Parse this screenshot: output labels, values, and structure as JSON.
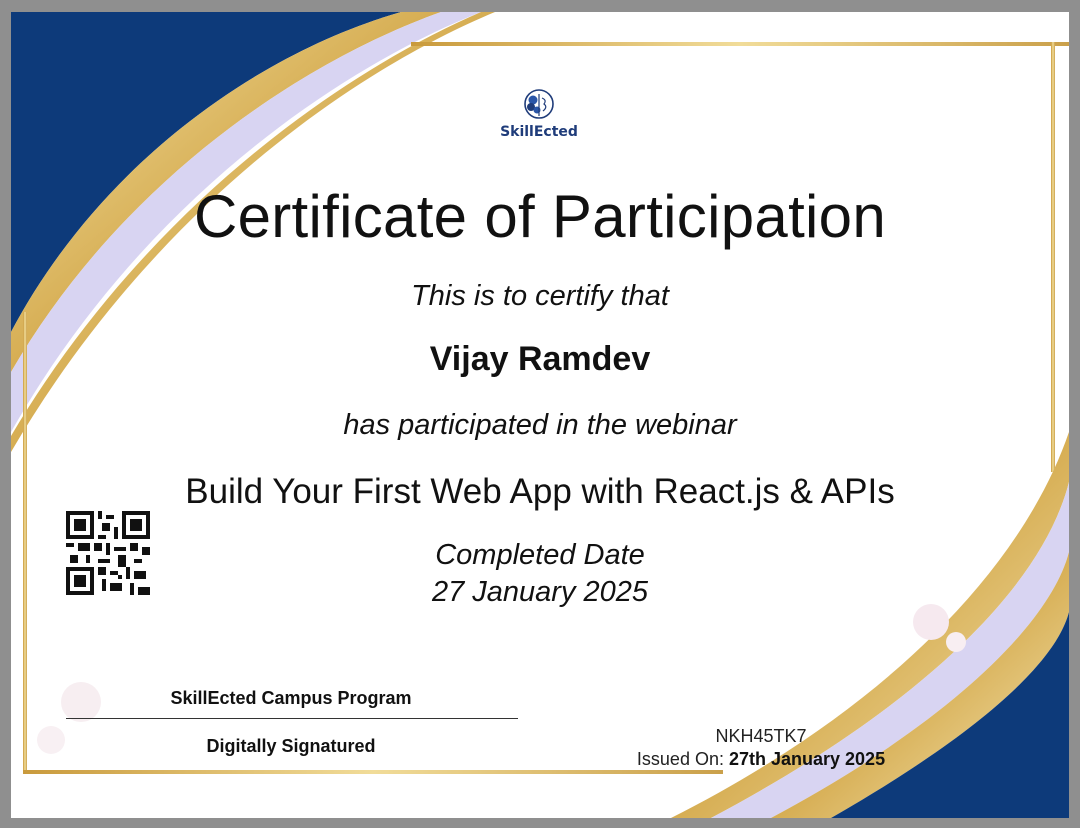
{
  "logo": {
    "brand": "SkillEcted",
    "icon": "brain-head-icon"
  },
  "certificate": {
    "title": "Certificate of Participation",
    "certify_line": "This is to certify that",
    "recipient": "Vijay Ramdev",
    "participation_line": "has participated in the webinar",
    "webinar_title": "Build Your First Web App with React.js & APIs",
    "completed_label": "Completed Date",
    "completed_date": "27 January 2025"
  },
  "footer": {
    "program": "SkillEcted Campus Program",
    "signature_note": "Digitally Signatured",
    "certificate_id": "NKH45TK7",
    "issued_label": "Issued On:",
    "issued_date": "27th January 2025"
  },
  "colors": {
    "navy": "#0d3a7a",
    "gold": "#d9b45a",
    "lavender": "#d8d4f2"
  }
}
